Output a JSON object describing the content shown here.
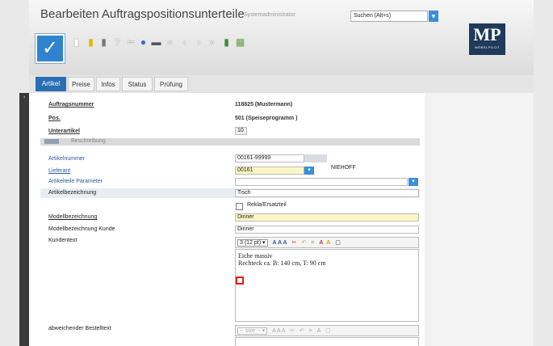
{
  "header": {
    "title": "Bearbeiten Auftragspositionsunterteile",
    "user": "Systemadministrator",
    "search_placeholder": "Suchen (Alt+s)",
    "logo": "MP",
    "logo_sub": "MÖBELPILOT"
  },
  "toolbar": {
    "icons": [
      "new-icon",
      "save-icon",
      "delete-icon",
      "help-icon",
      "back-icon",
      "search-icon",
      "print-icon",
      "first-icon",
      "prev-icon",
      "next-icon",
      "last-icon",
      "export-icon",
      "image-icon"
    ],
    "glyphs": [
      "▮",
      "▮",
      "▮",
      "?",
      "⇐",
      "🔍",
      "▬",
      "«",
      "‹",
      "›",
      "»",
      "▮",
      "▦"
    ]
  },
  "tabs": [
    "Artikel",
    "Preise",
    "Infos",
    "Status",
    "Prüfung"
  ],
  "form": {
    "auftragsnummer_label": "Auftragsnummer",
    "auftragsnummer_value": "118825 (Mustermann)",
    "pos_label": "Pos.",
    "pos_value": "501 (Speiseprogramm )",
    "unterartikel_label": "Unterartikel",
    "unterartikel_value": "10",
    "section_label": "Beschreibung",
    "artikelnummer_label": "Artikelnummer",
    "artikelnummer_value": "00161-99999",
    "lieferant_label": "Lieferant",
    "lieferant_value": "00161",
    "lieferant_name": "NIEHOFF",
    "artikelteile_label": "Artikelteile Parameter",
    "artikelbezeichnung_label": "Artikelbezeichnung",
    "artikelbezeichnung_value": "Tisch",
    "rekla_label": "Rekla/Ersatzteil",
    "modellbezeichnung_label": "Modellbezeichnung",
    "modellbezeichnung_value": "Dinner",
    "modellbezeichnung_kunde_label": "Modellbezeichnung Kunde",
    "modellbezeichnung_kunde_value": "Dinner",
    "kundentext_label": "Kundentext",
    "font_size_value": "3 (12 pt)",
    "kundentext_line1": "Eiche massiv",
    "kundentext_line2": "Rechteck ca. B: 140 cm, T: 90 cm",
    "bestelltext_label": "abweichender Bestelltext",
    "size_placeholder": "-- size --"
  }
}
